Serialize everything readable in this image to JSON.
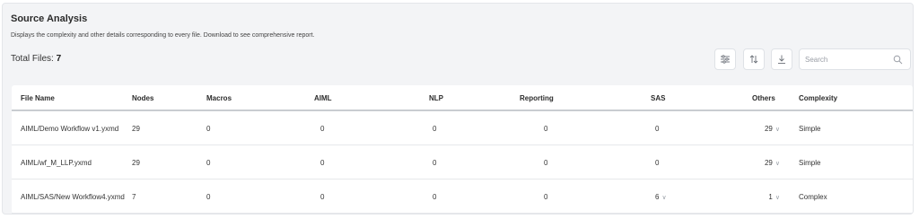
{
  "header": {
    "title": "Source Analysis",
    "subtitle": "Displays the complexity and other details corresponding to every file. Download to see comprehensive report.",
    "total_label": "Total Files:",
    "total_value": "7"
  },
  "toolbar": {
    "filter_icon": "sliders-icon",
    "sort_icon": "sort-arrows-icon",
    "download_icon": "download-icon",
    "search_placeholder": "Search",
    "search_value": ""
  },
  "table": {
    "columns": [
      "File Name",
      "Nodes",
      "Macros",
      "AIML",
      "NLP",
      "Reporting",
      "SAS",
      "Others",
      "Complexity"
    ],
    "rows": [
      {
        "file": "AIML/Demo Workflow v1.yxmd",
        "nodes": "29",
        "macros": "0",
        "aiml": "0",
        "nlp": "0",
        "reporting": "0",
        "sas": "0",
        "sas_expandable": false,
        "others": "29",
        "others_expandable": true,
        "complexity": "Simple"
      },
      {
        "file": "AIML/wf_M_LLP.yxmd",
        "nodes": "29",
        "macros": "0",
        "aiml": "0",
        "nlp": "0",
        "reporting": "0",
        "sas": "0",
        "sas_expandable": false,
        "others": "29",
        "others_expandable": true,
        "complexity": "Simple"
      },
      {
        "file": "AIML/SAS/New Workflow4.yxmd",
        "nodes": "7",
        "macros": "0",
        "aiml": "0",
        "nlp": "0",
        "reporting": "0",
        "sas": "6",
        "sas_expandable": true,
        "others": "1",
        "others_expandable": true,
        "complexity": "Complex"
      }
    ]
  },
  "colors": {
    "panel_bg": "#f3f4f6",
    "table_bg": "#ffffff",
    "header_border": "#c9ccd1",
    "chevron": "#9aa0a8"
  }
}
